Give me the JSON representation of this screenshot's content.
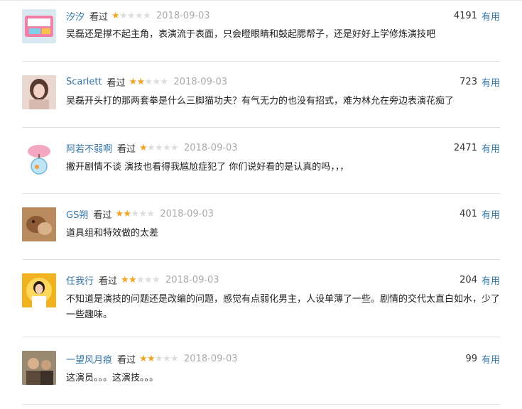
{
  "labels": {
    "useful": "有用"
  },
  "comments": [
    {
      "user": "汐汐",
      "status": "看过",
      "stars": 1,
      "date": "2018-09-03",
      "votes": "4191",
      "text": "吴磊还是撑不起主角，表演流于表面，只会瞪眼睛和鼓起腮帮子，还是好好上学修炼演技吧",
      "avatar_icon": "avatar-pink-box-icon"
    },
    {
      "user": "Scarlett",
      "status": "看过",
      "stars": 2,
      "date": "2018-09-03",
      "votes": "723",
      "text": "吴磊开头打的那两套拳是什么三脚猫功夫？有气无力的也没有招式，难为林允在旁边表演花痴了",
      "avatar_icon": "avatar-girl-portrait-icon"
    },
    {
      "user": "阿若不弱啊",
      "status": "看过",
      "stars": 1,
      "date": "2018-09-03",
      "votes": "2471",
      "text": "撇开剧情不谈 演技也看得我尴尬症犯了 你们说好看的是认真的吗，，，",
      "avatar_icon": "avatar-fishbowl-blossom-icon"
    },
    {
      "user": "GS朔",
      "status": "看过",
      "stars": 2,
      "date": "2018-09-03",
      "votes": "401",
      "text": "道具组和特效做的太差",
      "avatar_icon": "avatar-dog-photo-icon"
    },
    {
      "user": "任我行",
      "status": "看过",
      "stars": 2,
      "date": "2018-09-03",
      "votes": "204",
      "text": "不知道是演技的问题还是改编的问题，感觉有点弱化男主，人设单薄了一些。剧情的交代太直白如水，少了一些趣味。",
      "text_line2": "",
      "avatar_icon": "avatar-golden-figure-icon"
    },
    {
      "user": "一望风月痕",
      "status": "看过",
      "stars": 2,
      "date": "2018-09-03",
      "votes": "99",
      "text": "这演员。。。这演技。。。",
      "avatar_icon": "avatar-men-photo-icon"
    }
  ]
}
